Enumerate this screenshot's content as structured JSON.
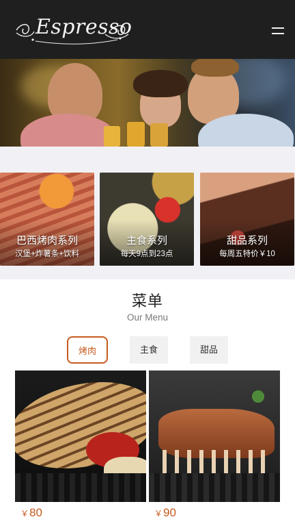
{
  "header": {
    "logo_text": "Espresso",
    "logo_icon": "espresso-script-logo",
    "menu_icon": "hamburger-icon"
  },
  "hero": {
    "image_description": "two men and a woman toasting with beer at a bar"
  },
  "categories": [
    {
      "title": "巴西烤肉系列",
      "subtitle": "汉堡+炸薯条+饮料"
    },
    {
      "title": "主食系列",
      "subtitle": "每天9点到23点"
    },
    {
      "title": "甜品系列",
      "subtitle": "每周五特价￥10"
    }
  ],
  "menu": {
    "title": "菜单",
    "subtitle": "Our Menu",
    "tabs": [
      {
        "label": "烤肉",
        "active": true
      },
      {
        "label": "主食",
        "active": false
      },
      {
        "label": "甜品",
        "active": false
      }
    ]
  },
  "dishes": [
    {
      "currency": "￥",
      "price": "80"
    },
    {
      "currency": "￥",
      "price": "90"
    }
  ],
  "colors": {
    "header_bg": "#1f1f1f",
    "accent": "#c75a1e",
    "section_bg": "#f1f1f5"
  }
}
